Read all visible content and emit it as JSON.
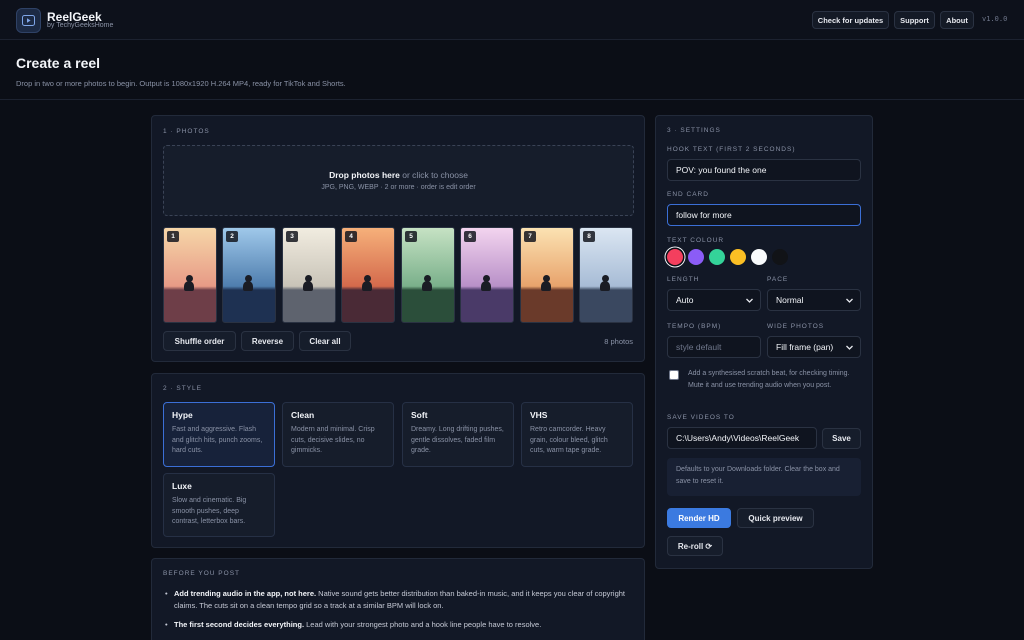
{
  "app": {
    "name": "ReelGeek",
    "subtitle": "by TechyGeeksHome",
    "version": "v1.0.0"
  },
  "topnav": {
    "check_updates": "Check for updates",
    "support": "Support",
    "about": "About"
  },
  "hero": {
    "title": "Create a reel",
    "description": "Drop in two or more photos to begin. Output is 1080x1920 H.264 MP4, ready for TikTok and Shorts."
  },
  "photos": {
    "section_title": "1 · PHOTOS",
    "dropzone_bold": "Drop photos here",
    "dropzone_rest": " or click to choose",
    "dropzone_hint": "JPG, PNG, WEBP · 2 or more · order is edit order",
    "thumbs": [
      {
        "num": "1",
        "top": "#f6d6a8",
        "mid": "#e79a86",
        "bottom": "#6e3e48"
      },
      {
        "num": "2",
        "top": "#9fc8ea",
        "mid": "#4f7eae",
        "bottom": "#1e3152"
      },
      {
        "num": "3",
        "top": "#f1ece0",
        "mid": "#c9c4b8",
        "bottom": "#5e636e"
      },
      {
        "num": "4",
        "top": "#f6b07a",
        "mid": "#d46a4c",
        "bottom": "#4a2a36"
      },
      {
        "num": "5",
        "top": "#c6e2c4",
        "mid": "#7ab08a",
        "bottom": "#2b4e3a"
      },
      {
        "num": "6",
        "top": "#f3d4ef",
        "mid": "#b890c8",
        "bottom": "#4a3a68"
      },
      {
        "num": "7",
        "top": "#fbe2b2",
        "mid": "#e8a36c",
        "bottom": "#6a3a2a"
      },
      {
        "num": "8",
        "top": "#dbe6f2",
        "mid": "#a7bcd6",
        "bottom": "#3a4860"
      }
    ],
    "shuffle": "Shuffle order",
    "reverse": "Reverse",
    "clear": "Clear all",
    "count": "8 photos"
  },
  "style": {
    "section_title": "2 · STYLE",
    "cards": [
      {
        "name": "Hype",
        "desc": "Fast and aggressive. Flash and glitch hits, punch zooms, hard cuts."
      },
      {
        "name": "Clean",
        "desc": "Modern and minimal. Crisp cuts, decisive slides, no gimmicks."
      },
      {
        "name": "Soft",
        "desc": "Dreamy. Long drifting pushes, gentle dissolves, faded film grade."
      },
      {
        "name": "VHS",
        "desc": "Retro camcorder. Heavy grain, colour bleed, glitch cuts, warm tape grade."
      },
      {
        "name": "Luxe",
        "desc": "Slow and cinematic. Big smooth pushes, deep contrast, letterbox bars."
      }
    ]
  },
  "tips": {
    "section_title": "BEFORE YOU POST",
    "items": [
      {
        "bold": "Add trending audio in the app, not here.",
        "text": " Native sound gets better distribution than baked-in music, and it keeps you clear of copyright claims. The cuts sit on a clean tempo grid so a track at a similar BPM will lock on."
      },
      {
        "bold": "The first second decides everything.",
        "text": " Lead with your strongest photo and a hook line people have to resolve."
      }
    ]
  },
  "settings": {
    "section_title": "3 · SETTINGS",
    "hook_label": "HOOK TEXT (FIRST 2 SECONDS)",
    "hook_value": "POV: you found the one",
    "endcard_label": "END CARD",
    "endcard_value": "follow for more",
    "colour_label": "TEXT COLOUR",
    "colours": [
      "#f43f5e",
      "#8b5cf6",
      "#34d399",
      "#fbbf24",
      "#f8fafc",
      "#111317"
    ],
    "length_label": "LENGTH",
    "length_value": "Auto",
    "pace_label": "PACE",
    "pace_value": "Normal",
    "tempo_label": "TEMPO (BPM)",
    "tempo_placeholder": "style default",
    "wide_label": "WIDE PHOTOS",
    "wide_value": "Fill frame (pan)",
    "scratch_note": "Add a synthesised scratch beat, for checking timing. Mute it and use trending audio when you post.",
    "save_label": "SAVE VIDEOS TO",
    "save_path": "C:\\Users\\Andy\\Videos\\ReelGeek",
    "save_button": "Save",
    "save_info": "Defaults to your Downloads folder. Clear the box and save to reset it.",
    "render_hd": "Render HD",
    "quick_preview": "Quick preview",
    "reroll": "Re-roll ⟳"
  }
}
